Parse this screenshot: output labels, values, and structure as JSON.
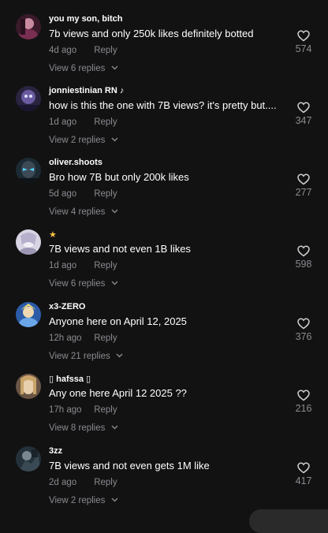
{
  "comments": [
    {
      "username": "you my son, bitch",
      "text": "7b views and only 250k likes definitely botted",
      "time": "4d ago",
      "reply_label": "Reply",
      "replies_label": "View 6 replies",
      "likes": "574"
    },
    {
      "username": "jonniestinian RN ♪",
      "text": "how is this the one with 7B views? it's pretty but....",
      "time": "1d ago",
      "reply_label": "Reply",
      "replies_label": "View 2 replies",
      "likes": "347"
    },
    {
      "username": "oliver.shoots",
      "text": "Bro how 7B but only 200k likes",
      "time": "5d ago",
      "reply_label": "Reply",
      "replies_label": "View 4 replies",
      "likes": "277"
    },
    {
      "username": "★",
      "text": "7B views and not even 1B likes",
      "time": "1d ago",
      "reply_label": "Reply",
      "replies_label": "View 6 replies",
      "likes": "598"
    },
    {
      "username": "x3-ZERO",
      "text": "Anyone here on April 12, 2025",
      "time": "12h ago",
      "reply_label": "Reply",
      "replies_label": "View 21 replies",
      "likes": "376"
    },
    {
      "username": "▯ hafssa ▯",
      "text": "Any one here April 12 2025 ??",
      "time": "17h ago",
      "reply_label": "Reply",
      "replies_label": "View 8 replies",
      "likes": "216"
    },
    {
      "username": "3zz",
      "text": "7B views and not even gets 1M like",
      "time": "2d ago",
      "reply_label": "Reply",
      "replies_label": "View 2 replies",
      "likes": "417"
    }
  ],
  "icons": {
    "like": "heart-outline-icon",
    "expand": "chevron-down-icon"
  },
  "colors": {
    "background": "#121212",
    "text_primary": "#ffffff",
    "text_secondary": "#8a8b91",
    "star": "#f5c242"
  }
}
